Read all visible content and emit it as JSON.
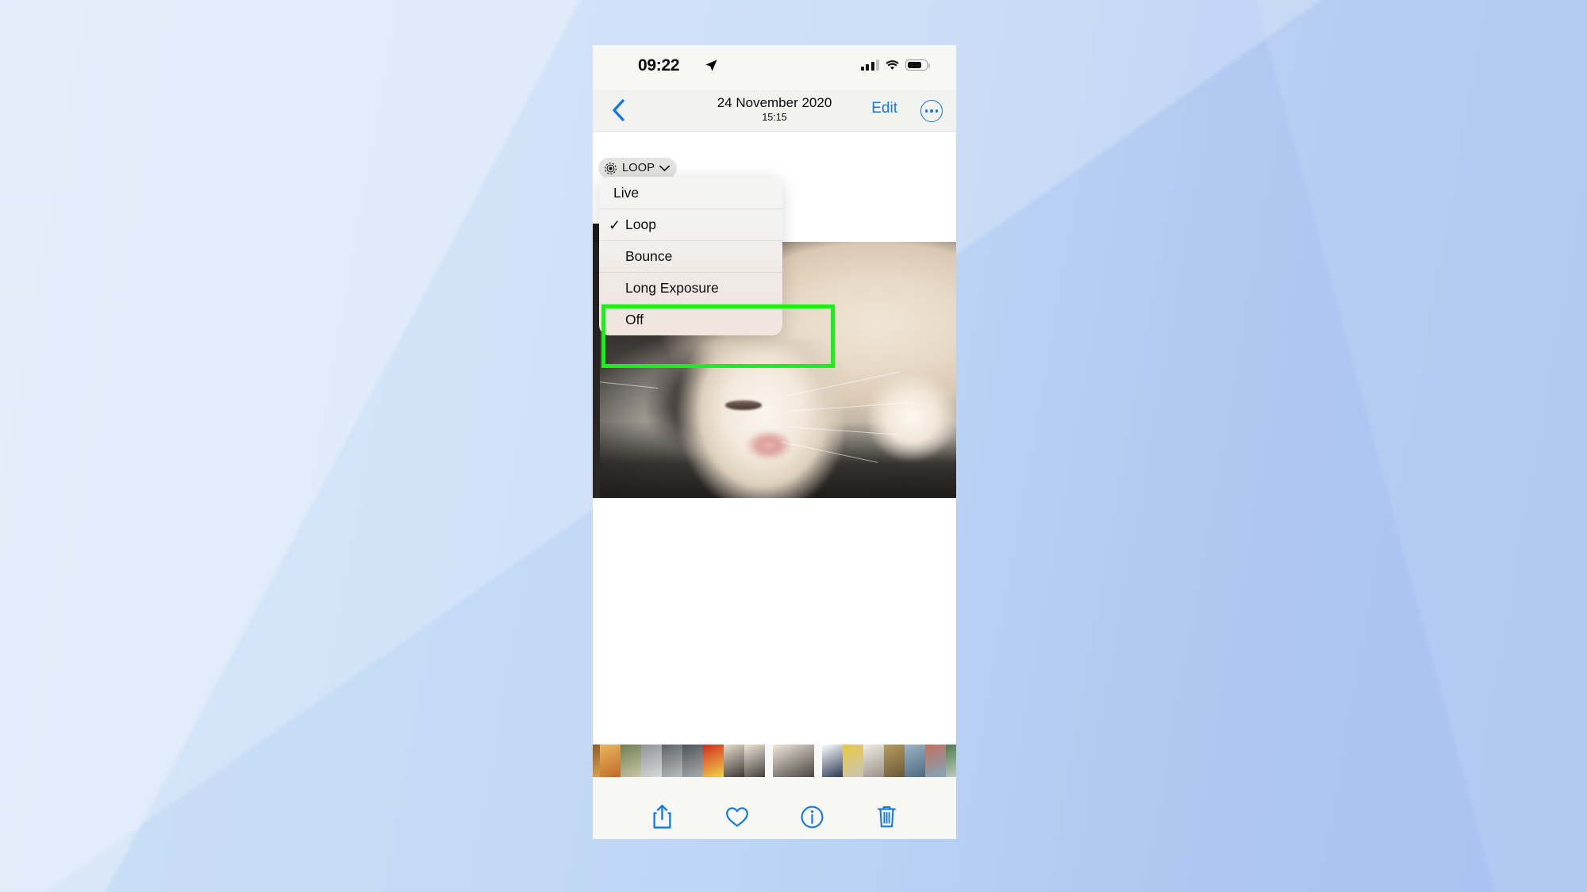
{
  "background": {
    "color_left": "#cbdff7",
    "color_right": "#a9c2f0"
  },
  "phone": {
    "status_bar": {
      "time": "09:22",
      "location_icon": "location-arrow-icon",
      "cellular_icon": "signal-bars-icon",
      "cellular_bars_filled": 3,
      "cellular_bars_total": 4,
      "wifi_icon": "wifi-icon",
      "battery_icon": "battery-icon",
      "battery_level_percent": 76
    },
    "nav_bar": {
      "back_icon": "chevron-left-icon",
      "date": "24 November 2020",
      "time": "15:15",
      "edit_label": "Edit",
      "more_icon": "ellipsis-circle-icon"
    },
    "live_badge": {
      "icon": "live-photo-icon",
      "label": "LOOP",
      "chevron_icon": "chevron-down-icon"
    },
    "menu": {
      "items": [
        {
          "label": "Live",
          "checked": false
        },
        {
          "label": "Loop",
          "checked": true
        },
        {
          "label": "Bounce",
          "checked": false
        },
        {
          "label": "Long Exposure",
          "checked": false
        },
        {
          "label": "Off",
          "checked": false
        }
      ],
      "check_glyph": "✓"
    },
    "highlight": {
      "color": "#18f018",
      "covers": [
        "Loop",
        "Bounce"
      ]
    },
    "photo": {
      "alt": "sleeping white and grey cat close-up"
    },
    "filmstrip": {
      "thumbnails": [
        {
          "name": "thumb-food",
          "c1": "#8e5a2a",
          "c2": "#d9a24a"
        },
        {
          "name": "thumb-pizza",
          "c1": "#e8b75c",
          "c2": "#c2692c"
        },
        {
          "name": "thumb-window",
          "c1": "#6f7d52",
          "c2": "#c9c6a8"
        },
        {
          "name": "thumb-tap",
          "c1": "#8f9499",
          "c2": "#d6d8d6"
        },
        {
          "name": "thumb-faucet",
          "c1": "#5d6368",
          "c2": "#b9bcbe"
        },
        {
          "name": "thumb-faucet-2",
          "c1": "#4f5458",
          "c2": "#a9acae"
        },
        {
          "name": "thumb-poster",
          "c1": "#d12b20",
          "c2": "#f2d24a"
        },
        {
          "name": "thumb-cat-a",
          "c1": "#e9ded0",
          "c2": "#3d3a37"
        },
        {
          "name": "thumb-cat-b",
          "c1": "#efe6da",
          "c2": "#45423e"
        },
        {
          "name": "thumb-cat-current",
          "c1": "#f0e7dc",
          "c2": "#4a4642"
        },
        {
          "name": "thumb-screenshot",
          "c1": "#ffffff",
          "c2": "#2b3a54"
        },
        {
          "name": "thumb-kitchen",
          "c1": "#e8c93f",
          "c2": "#c9c4b6"
        },
        {
          "name": "thumb-newspaper",
          "c1": "#f1ece2",
          "c2": "#9a9287"
        },
        {
          "name": "thumb-board",
          "c1": "#b59b5f",
          "c2": "#6a5a3a"
        },
        {
          "name": "thumb-harbour",
          "c1": "#9cb4c6",
          "c2": "#4e6a7d"
        },
        {
          "name": "thumb-houses",
          "c1": "#c3705d",
          "c2": "#7fa6bb"
        },
        {
          "name": "thumb-lego",
          "c1": "#4a7a4e",
          "c2": "#cfd4cc"
        },
        {
          "name": "thumb-room",
          "c1": "#8b6a4a",
          "c2": "#d8cbb7"
        },
        {
          "name": "thumb-desk",
          "c1": "#c8a87e",
          "c2": "#6d5840"
        }
      ]
    },
    "toolbar": {
      "buttons": [
        {
          "name": "share-button",
          "icon": "share-icon"
        },
        {
          "name": "favourite-button",
          "icon": "heart-icon"
        },
        {
          "name": "info-button",
          "icon": "info-icon"
        },
        {
          "name": "delete-button",
          "icon": "trash-icon"
        }
      ],
      "accent_color": "#1378e8"
    },
    "home_indicator": "home-indicator"
  }
}
